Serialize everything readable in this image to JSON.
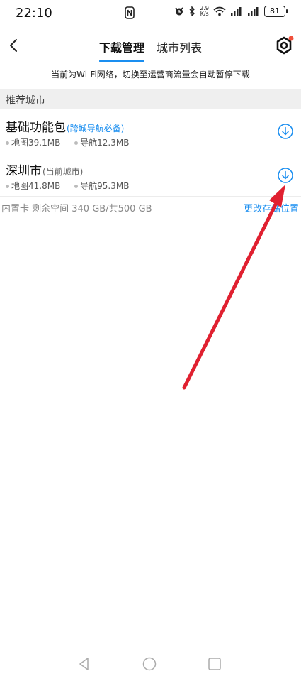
{
  "status_bar": {
    "time": "22:10",
    "net_speed_value": "2.9",
    "net_speed_unit": "K/s",
    "battery": "81"
  },
  "tabs": [
    {
      "label": "下载管理",
      "active": true
    },
    {
      "label": "城市列表",
      "active": false
    }
  ],
  "notice": "当前为Wi-Fi网络，切换至运营商流量会自动暂停下载",
  "section": {
    "title": "推荐城市"
  },
  "cities": [
    {
      "name": "基础功能包",
      "tag": "(跨城导航必备)",
      "map_size": "地图39.1MB",
      "nav_size": "导航12.3MB"
    },
    {
      "name": "深圳市",
      "tag": "(当前城市)",
      "map_size": "地图41.8MB",
      "nav_size": "导航95.3MB"
    }
  ],
  "storage": {
    "info": "内置卡 剩余空间 340 GB/共500 GB",
    "change_label": "更改存储位置"
  },
  "colors": {
    "accent": "#1a8ef0",
    "annotation_arrow": "#e02030",
    "settings_badge": "#f0503c"
  },
  "icons": {
    "back": "chevron-left-icon",
    "settings": "settings-icon",
    "download": "download-circle-icon",
    "nav_back": "triangle-back-icon",
    "nav_home": "circle-home-icon",
    "nav_recents": "square-recents-icon"
  }
}
